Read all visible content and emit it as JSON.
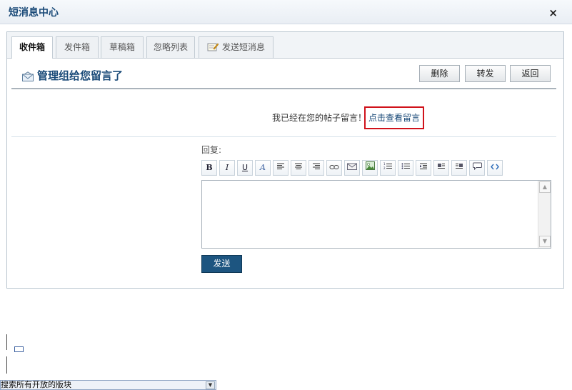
{
  "dialog": {
    "title": "短消息中心",
    "close_label": "×"
  },
  "tabs": [
    {
      "label": "收件箱",
      "active": true
    },
    {
      "label": "发件箱",
      "active": false
    },
    {
      "label": "草稿箱",
      "active": false
    },
    {
      "label": "忽略列表",
      "active": false
    },
    {
      "label": "发送短消息",
      "active": false,
      "icon": "compose-icon"
    }
  ],
  "message": {
    "subject": "管理组给您留言了",
    "subject_icon": "envelope-icon",
    "body_text": "我已经在您的帖子留言！",
    "link_text": "点击查看留言",
    "actions": {
      "delete": "删除",
      "forward": "转发",
      "back": "返回"
    }
  },
  "reply": {
    "label": "回复:",
    "toolbar": {
      "bold": "B",
      "italic": "I",
      "underline": "U",
      "font_color": "A"
    },
    "send_label": "发送"
  },
  "background": {
    "dropdown_text": "搜索所有开放的版块"
  },
  "colors": {
    "accent": "#1a4a78",
    "send_button": "#1d5580",
    "highlight_border": "#d0121b"
  }
}
